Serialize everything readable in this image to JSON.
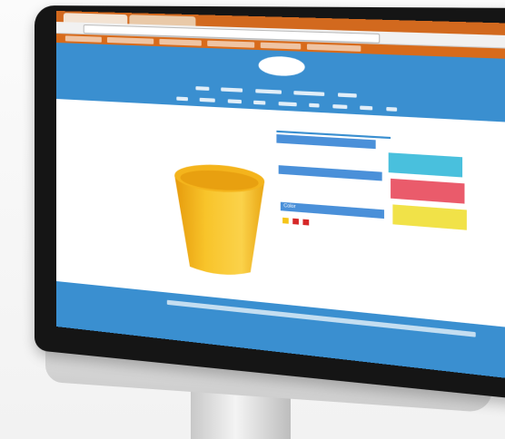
{
  "scene": {
    "description_colors": {
      "header_blue": "#3a8fd0",
      "browser_orange": "#d2691e",
      "cup_yellow": "#f6b81c"
    }
  },
  "browser": {
    "tabs": [
      "",
      ""
    ]
  },
  "product": {
    "section1_label": "",
    "name": "",
    "section2_label": "",
    "detail_lines": [
      "",
      ""
    ],
    "color_label": "Color",
    "color_swatches": [
      "#f5c518",
      "#d62828",
      "#d62828"
    ],
    "note_lines": [
      "",
      ""
    ]
  },
  "actions": {
    "btn1": "",
    "btn2": "",
    "btn3": ""
  },
  "footer": {
    "text": ""
  }
}
